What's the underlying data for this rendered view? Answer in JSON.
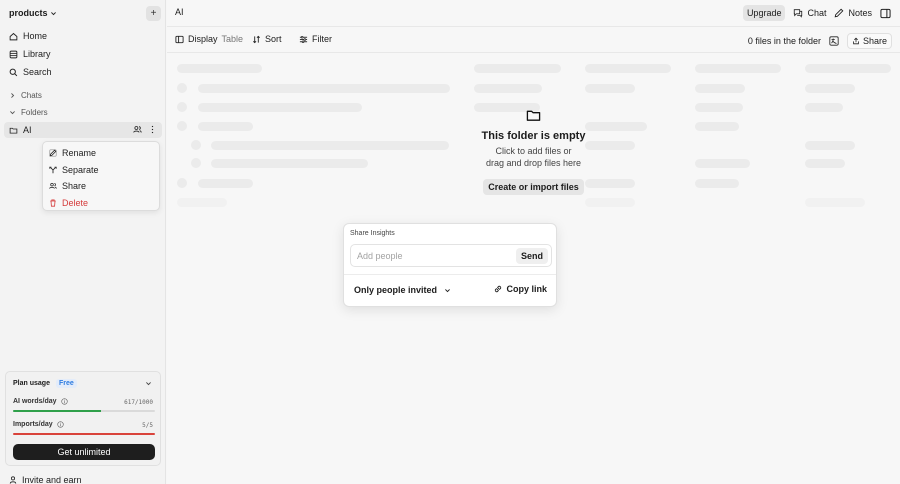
{
  "sidebar": {
    "workspace": "products",
    "nav": [
      {
        "label": "Home",
        "icon": "home-icon"
      },
      {
        "label": "Library",
        "icon": "library-icon"
      },
      {
        "label": "Search",
        "icon": "search-icon"
      }
    ],
    "sections": {
      "chats": "Chats",
      "folders": "Folders"
    },
    "folder_item": "AI",
    "context_menu": [
      {
        "label": "Rename",
        "icon": "pencil-icon",
        "danger": false
      },
      {
        "label": "Separate",
        "icon": "split-icon",
        "danger": false
      },
      {
        "label": "Share",
        "icon": "users-icon",
        "danger": false
      },
      {
        "label": "Delete",
        "icon": "trash-icon",
        "danger": true
      }
    ],
    "plan": {
      "title": "Plan usage",
      "badge": "Free",
      "ai_words_label": "AI words/day",
      "ai_words_count": "617/1000",
      "ai_words_fraction": 0.617,
      "imports_label": "Imports/day",
      "imports_count": "5/5",
      "imports_fraction": 1.0,
      "cta": "Get unlimited"
    },
    "invite": "Invite and earn"
  },
  "header": {
    "breadcrumb": "AI",
    "upgrade": "Upgrade",
    "chat": "Chat",
    "notes": "Notes"
  },
  "toolbar": {
    "display": "Display",
    "display_value": "Table",
    "sort": "Sort",
    "filter": "Filter",
    "file_count": "0 files in the folder",
    "share": "Share"
  },
  "empty_state": {
    "title": "This folder is empty",
    "line1": "Click to add files or",
    "line2": "drag and drop files here",
    "cta": "Create or import files"
  },
  "share_dialog": {
    "title": "Share Insights",
    "placeholder": "Add people",
    "send": "Send",
    "access": "Only people invited",
    "copy_link": "Copy link"
  },
  "colors": {
    "ai_words_bar": "#2fa04a",
    "imports_bar": "#d9433b",
    "danger": "#d53b3b",
    "accent": "#2d7be0"
  }
}
